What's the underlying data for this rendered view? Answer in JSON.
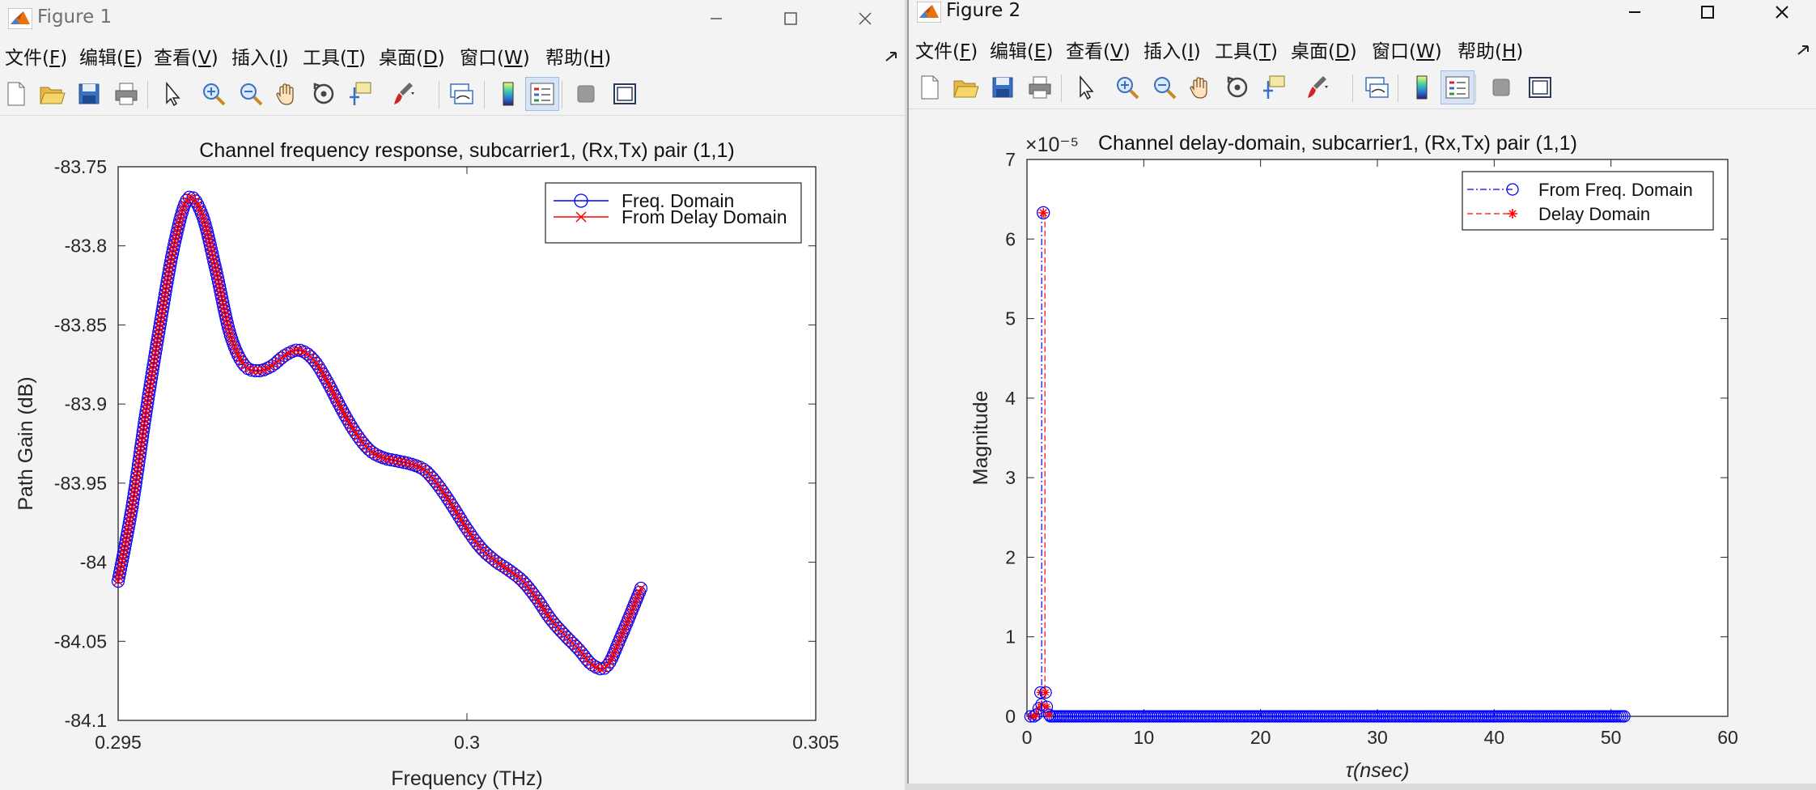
{
  "fig1": {
    "title": "Figure 1",
    "menus": [
      {
        "pre": "文件(",
        "key": "F",
        "post": ")"
      },
      {
        "pre": "编辑(",
        "key": "E",
        "post": ")"
      },
      {
        "pre": "查看(",
        "key": "V",
        "post": ")"
      },
      {
        "pre": "插入(",
        "key": "I",
        "post": ")"
      },
      {
        "pre": "工具(",
        "key": "T",
        "post": ")"
      },
      {
        "pre": "桌面(",
        "key": "D",
        "post": ")"
      },
      {
        "pre": "窗口(",
        "key": "W",
        "post": ")"
      },
      {
        "pre": "帮助(",
        "key": "H",
        "post": ")"
      }
    ]
  },
  "fig2": {
    "title": "Figure 2",
    "menus": [
      {
        "pre": "文件(",
        "key": "F",
        "post": ")"
      },
      {
        "pre": "编辑(",
        "key": "E",
        "post": ")"
      },
      {
        "pre": "查看(",
        "key": "V",
        "post": ")"
      },
      {
        "pre": "插入(",
        "key": "I",
        "post": ")"
      },
      {
        "pre": "工具(",
        "key": "T",
        "post": ")"
      },
      {
        "pre": "桌面(",
        "key": "D",
        "post": ")"
      },
      {
        "pre": "窗口(",
        "key": "W",
        "post": ")"
      },
      {
        "pre": "帮助(",
        "key": "H",
        "post": ")"
      }
    ]
  },
  "toolbar_icons": [
    "new-file-icon",
    "open-folder-icon",
    "save-icon",
    "print-icon",
    "pointer-icon",
    "zoom-in-icon",
    "zoom-out-icon",
    "pan-hand-icon",
    "rotate-3d-icon",
    "data-cursor-icon",
    "brush-icon",
    "link-plot-icon",
    "colorbar-icon",
    "legend-icon",
    "hide-plot-tools-icon",
    "show-plot-tools-icon"
  ],
  "chart_data": [
    {
      "type": "line",
      "title": "Channel frequency response, subcarrier1, (Rx,Tx) pair (1,1)",
      "xlabel": "Frequency (THz)",
      "ylabel": "Path Gain (dB)",
      "xlim": [
        0.295,
        0.305
      ],
      "ylim": [
        -84.1,
        -83.75
      ],
      "xticks": [
        "0.295",
        "0.3",
        "0.305"
      ],
      "yticks": [
        "-83.75",
        "-83.8",
        "-83.85",
        "-83.9",
        "-83.95",
        "-84",
        "-84.05",
        "-84.1"
      ],
      "grid": false,
      "legend_position": "top-right",
      "series": [
        {
          "name": "Freq. Domain",
          "color": "#0000ff",
          "marker": "circle",
          "line": "solid"
        },
        {
          "name": "From Delay Domain",
          "color": "#ff0000",
          "marker": "x",
          "line": "solid"
        }
      ],
      "curve_points": [
        [
          0.295,
          -84.012
        ],
        [
          0.2952,
          -83.965
        ],
        [
          0.2954,
          -83.905
        ],
        [
          0.2956,
          -83.85
        ],
        [
          0.2958,
          -83.8
        ],
        [
          0.296,
          -83.77
        ],
        [
          0.2962,
          -83.78
        ],
        [
          0.2964,
          -83.815
        ],
        [
          0.2966,
          -83.855
        ],
        [
          0.2968,
          -83.875
        ],
        [
          0.297,
          -83.879
        ],
        [
          0.2972,
          -83.876
        ],
        [
          0.2974,
          -83.869
        ],
        [
          0.2976,
          -83.866
        ],
        [
          0.2978,
          -83.872
        ],
        [
          0.298,
          -83.886
        ],
        [
          0.2982,
          -83.903
        ],
        [
          0.2984,
          -83.918
        ],
        [
          0.2986,
          -83.929
        ],
        [
          0.2988,
          -83.934
        ],
        [
          0.299,
          -83.936
        ],
        [
          0.2992,
          -83.938
        ],
        [
          0.2994,
          -83.942
        ],
        [
          0.2996,
          -83.952
        ],
        [
          0.2998,
          -83.965
        ],
        [
          0.3,
          -83.979
        ],
        [
          0.3002,
          -83.991
        ],
        [
          0.3004,
          -83.999
        ],
        [
          0.3006,
          -84.005
        ],
        [
          0.3008,
          -84.012
        ],
        [
          0.301,
          -84.023
        ],
        [
          0.3012,
          -84.036
        ],
        [
          0.3014,
          -84.046
        ],
        [
          0.3016,
          -84.055
        ],
        [
          0.3018,
          -84.065
        ],
        [
          0.302,
          -84.066
        ],
        [
          0.3022,
          -84.048
        ],
        [
          0.3025,
          -84.016
        ]
      ]
    },
    {
      "type": "scatter",
      "title": "Channel delay-domain, subcarrier1, (Rx,Tx) pair (1,1)",
      "xlabel": "τ(nsec)",
      "ylabel": "Magnitude",
      "exponent_label": "×10⁻⁵",
      "xlim": [
        0,
        60
      ],
      "ylim": [
        0,
        7
      ],
      "xticks": [
        "0",
        "10",
        "20",
        "30",
        "40",
        "50",
        "60"
      ],
      "yticks": [
        "0",
        "1",
        "2",
        "3",
        "4",
        "5",
        "6",
        "7"
      ],
      "grid": false,
      "legend_position": "top-right",
      "series": [
        {
          "name": "From Freq. Domain",
          "color": "#0000ff",
          "marker": "circle",
          "line": "dash-dot"
        },
        {
          "name": "Delay Domain",
          "color": "#ff0000",
          "marker": "asterisk",
          "line": "dashed"
        }
      ],
      "peak": {
        "x": 1.4,
        "y": 6.33
      },
      "near_peak": [
        [
          0.3,
          0
        ],
        [
          0.6,
          0
        ],
        [
          0.8,
          0.02
        ],
        [
          1.0,
          0.1
        ],
        [
          1.15,
          0.3
        ],
        [
          1.25,
          0.15
        ],
        [
          1.6,
          0.3
        ],
        [
          1.7,
          0.12
        ],
        [
          1.9,
          0.02
        ]
      ],
      "x_range_zero": [
        2,
        51.2
      ]
    }
  ]
}
